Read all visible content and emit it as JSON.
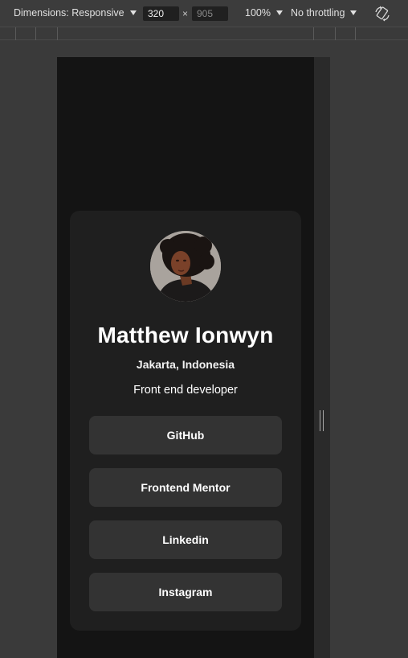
{
  "toolbar": {
    "dimensions_label": "Dimensions: Responsive",
    "width_value": "320",
    "height_placeholder": "905",
    "times": "×",
    "zoom_label": "100%",
    "throttle_label": "No throttling",
    "rotate_icon": "rotate-device-icon"
  },
  "profile": {
    "name": "Matthew Ionwyn",
    "location": "Jakarta, Indonesia",
    "bio": "Front end developer",
    "avatar_icon": "avatar",
    "links": [
      {
        "label": "GitHub"
      },
      {
        "label": "Frontend Mentor"
      },
      {
        "label": "Linkedin"
      },
      {
        "label": "Instagram"
      }
    ]
  },
  "colors": {
    "page_background": "#141414",
    "card_background": "#1f1f1f",
    "button_background": "#333333",
    "text": "#ffffff"
  }
}
